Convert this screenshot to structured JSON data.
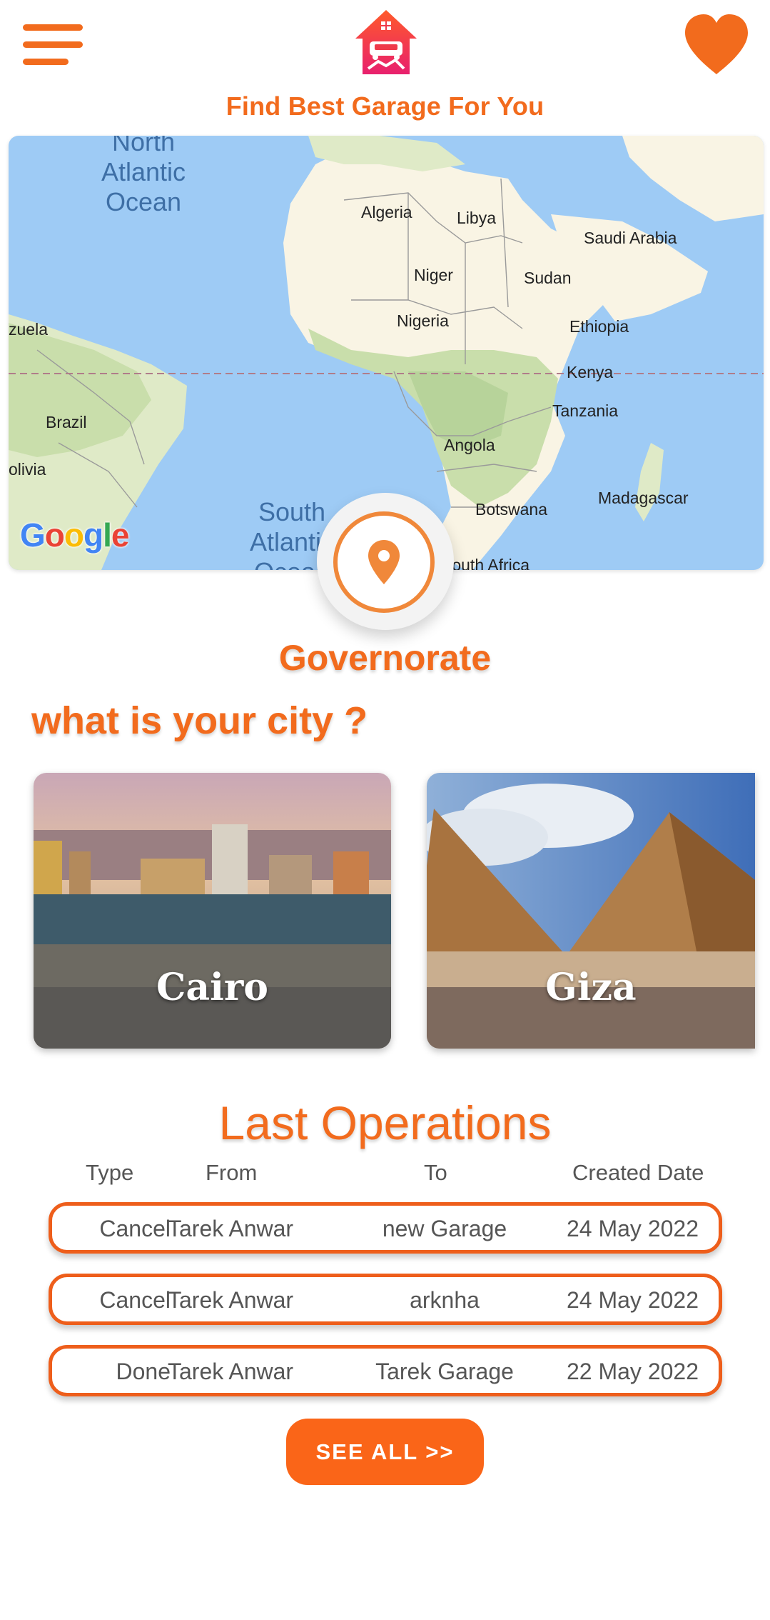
{
  "header": {
    "title": "Find Best Garage For You",
    "menu_icon": "hamburger-menu-icon",
    "logo_icon": "garage-house-car-logo",
    "favorite_icon": "heart-icon"
  },
  "map": {
    "attribution": "Google",
    "labels": {
      "north_atlantic": "North\nAtlantic\nOcean",
      "south_atlantic": "South\nAtlantic\nOcean",
      "algeria": "Algeria",
      "libya": "Libya",
      "saudi_arabia": "Saudi Arabia",
      "niger": "Niger",
      "sudan": "Sudan",
      "nigeria": "Nigeria",
      "ethiopia": "Ethiopia",
      "venezuela": "zuela",
      "kenya": "Kenya",
      "tanzania": "Tanzania",
      "brazil": "Brazil",
      "angola": "Angola",
      "bolivia": "olivia",
      "madagascar": "Madagascar",
      "botswana": "Botswana",
      "south_africa": "South Africa"
    },
    "location_button_icon": "location-pin-icon"
  },
  "governorate": {
    "title": "Governorate",
    "question": "what is your city ?",
    "cities": [
      {
        "name": "Cairo"
      },
      {
        "name": "Giza"
      }
    ]
  },
  "operations": {
    "title": "Last Operations",
    "columns": {
      "type": "Type",
      "from": "From",
      "to": "To",
      "date": "Created Date"
    },
    "rows": [
      {
        "type": "Cancel",
        "from": "Tarek Anwar",
        "to": "new Garage",
        "date": "24 May 2022"
      },
      {
        "type": "Cancel",
        "from": "Tarek Anwar",
        "to": "arknha",
        "date": "24 May 2022"
      },
      {
        "type": "Done",
        "from": "Tarek Anwar",
        "to": "Tarek Garage",
        "date": "22 May 2022"
      }
    ],
    "see_all": "SEE ALL >>"
  },
  "colors": {
    "accent": "#f26b1d",
    "button": "#fa6518",
    "row_border": "#ee5e1b"
  }
}
